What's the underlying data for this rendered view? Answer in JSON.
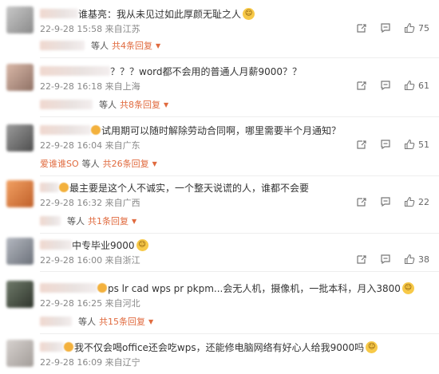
{
  "comments": [
    {
      "text": "谁基亮：我从未见过如此厚颜无耻之人",
      "date": "22-9-28 15:58",
      "location": "来自江苏",
      "likes": "75",
      "reply_who": "",
      "reply_deng": "等人",
      "reply_total": "共4条回复"
    },
    {
      "text": "？？？word都不会用的普通人月薪9000？？",
      "date": "22-9-28 16:18",
      "location": "来自上海",
      "likes": "61",
      "reply_who": "",
      "reply_deng": "等人",
      "reply_total": "共8条回复"
    },
    {
      "text": "试用期可以随时解除劳动合同啊，哪里需要半个月通知？",
      "date": "22-9-28 16:04",
      "location": "来自广东",
      "likes": "51",
      "reply_who": "爱谁谁SO",
      "reply_deng": "等人",
      "reply_total": "共26条回复"
    },
    {
      "text": "最主要是这个人不诚实，一个整天说谎的人，谁都不会要",
      "date": "22-9-28 16:32",
      "location": "来自广西",
      "likes": "22",
      "reply_who": "",
      "reply_deng": "等人",
      "reply_total": "共1条回复"
    },
    {
      "text": "中专毕业9000",
      "date": "22-9-28 16:00",
      "location": "来自浙江",
      "likes": "38",
      "reply_who": "",
      "reply_deng": "",
      "reply_total": ""
    },
    {
      "text": "ps lr cad  wps pr pkpm...会无人机，摄像机，一批本科，月入3800",
      "date": "22-9-28 16:25",
      "location": "来自河北",
      "likes": "",
      "reply_who": "",
      "reply_deng": "等人",
      "reply_total": "共15条回复"
    },
    {
      "text": "我不仅会喝office还会吃wps，还能修电脑网络有好心人给我9000吗",
      "date": "22-9-28 16:09",
      "location": "来自辽宁",
      "likes": "",
      "reply_who": "",
      "reply_deng": "",
      "reply_total": ""
    }
  ]
}
